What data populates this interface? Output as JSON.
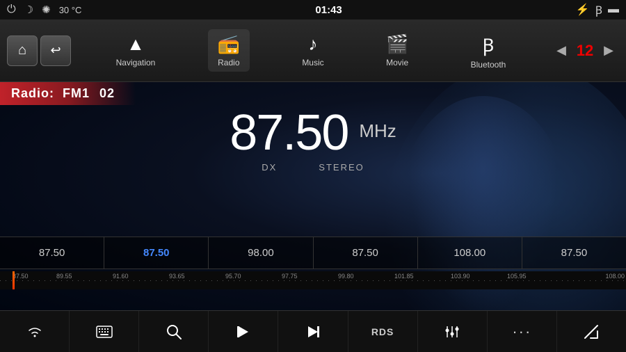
{
  "status": {
    "time": "01:43",
    "temp": "30 °C",
    "usb_icon": "⚡",
    "bt_icon": "bluetooth",
    "window_icon": "▬"
  },
  "nav": {
    "back_label": "◀",
    "home_label": "▲",
    "items": [
      {
        "id": "navigation",
        "icon": "▲",
        "label": "Navigation"
      },
      {
        "id": "radio",
        "icon": "📻",
        "label": "Radio"
      },
      {
        "id": "music",
        "icon": "♪",
        "label": "Music"
      },
      {
        "id": "movie",
        "icon": "🎬",
        "label": "Movie"
      },
      {
        "id": "bluetooth",
        "icon": "🔷",
        "label": "Bluetooth"
      }
    ],
    "arrow_left": "◀",
    "channel_number": "12",
    "arrow_right": "▶"
  },
  "radio": {
    "mode_label": "Radio:",
    "band": "FM1",
    "channel": "02",
    "frequency": "87.50",
    "unit": "MHz",
    "sub_label_left": "DX",
    "sub_label_right": "STEREO"
  },
  "presets": [
    {
      "freq": "87.50",
      "active": false
    },
    {
      "freq": "87.50",
      "active": true
    },
    {
      "freq": "98.00",
      "active": false
    },
    {
      "freq": "87.50",
      "active": false
    },
    {
      "freq": "108.00",
      "active": false
    },
    {
      "freq": "87.50",
      "active": false
    }
  ],
  "scale": {
    "markers": [
      "87.50",
      "89.55",
      "91.60",
      "93.65",
      "95.70",
      "97.75",
      "99.80",
      "101.85",
      "103.90",
      "105.95",
      "108.00"
    ]
  },
  "bottom_toolbar": [
    {
      "id": "wifi",
      "icon": "≋",
      "label": "wifi"
    },
    {
      "id": "keyboard",
      "icon": "⌨",
      "label": "keyboard"
    },
    {
      "id": "search",
      "icon": "⌕",
      "label": "search"
    },
    {
      "id": "prev",
      "icon": "⏮",
      "label": "previous"
    },
    {
      "id": "next",
      "icon": "⏭",
      "label": "next"
    },
    {
      "id": "rds",
      "icon": "RDS",
      "label": "rds",
      "is_text": true
    },
    {
      "id": "eq",
      "icon": "🎛",
      "label": "equalizer"
    },
    {
      "id": "more",
      "icon": "···",
      "label": "more"
    },
    {
      "id": "mute",
      "icon": "↙",
      "label": "mute"
    }
  ]
}
